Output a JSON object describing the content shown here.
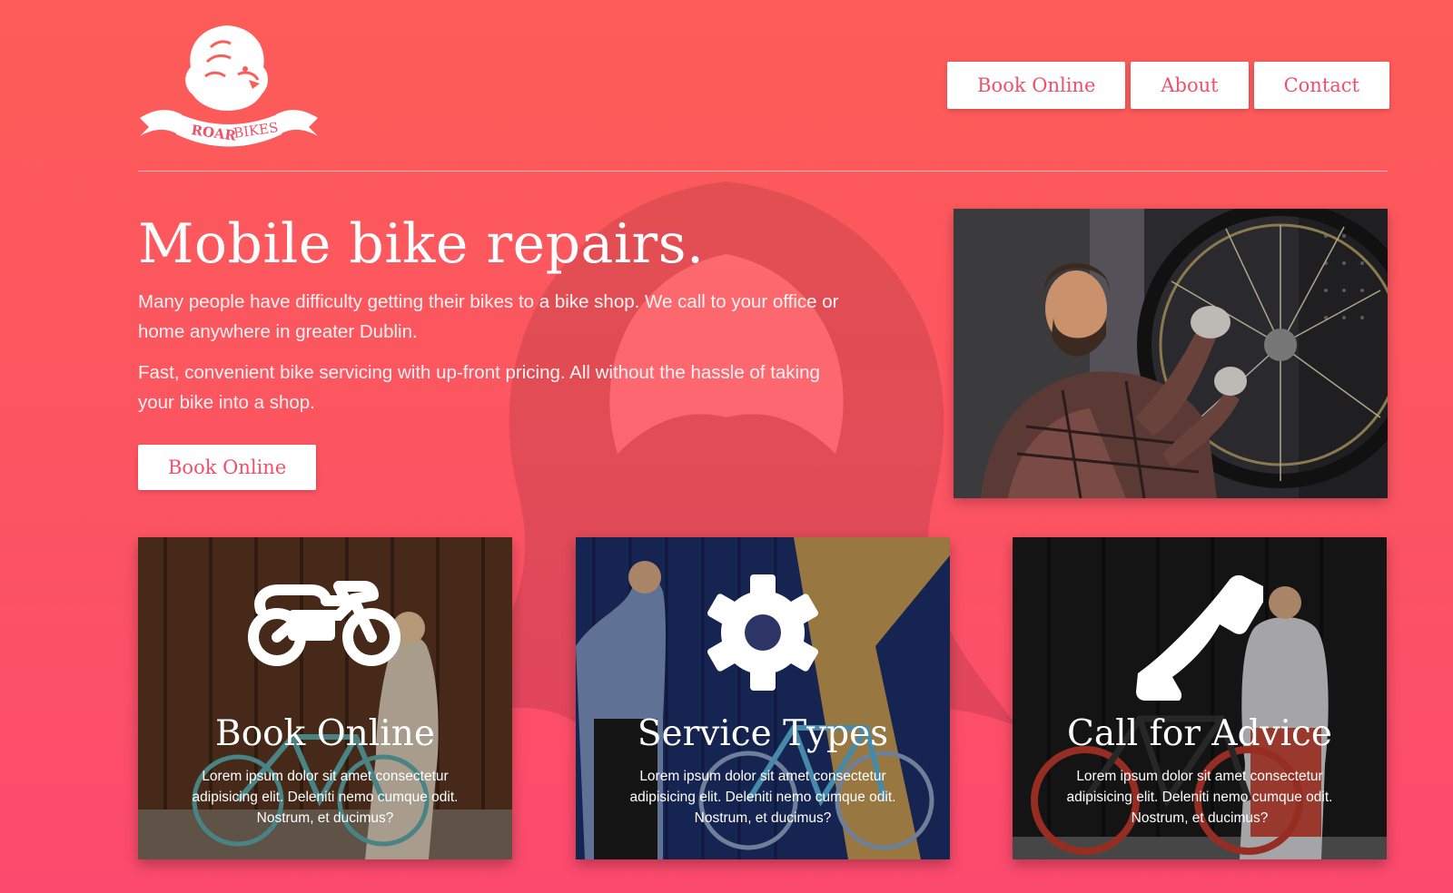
{
  "brand": {
    "logo_text_1": "ROAR",
    "logo_text_2": "BIKES",
    "colors": {
      "background_top": "#fd5c58",
      "background_bottom": "#fc4a6e",
      "button_text": "#f0506a",
      "button_bg": "#ffffff"
    }
  },
  "nav": {
    "items": [
      {
        "label": "Book Online"
      },
      {
        "label": "About"
      },
      {
        "label": "Contact"
      }
    ]
  },
  "hero": {
    "title": "Mobile bike repairs.",
    "paragraph_1": "Many people have difficulty getting their bikes to a bike shop. We call to your office or home anywhere in greater Dublin.",
    "paragraph_2": "Fast, convenient bike servicing with up-front pricing. All without the hassle of taking your bike into a shop.",
    "cta_label": "Book Online"
  },
  "features": [
    {
      "icon": "motorcycle-icon",
      "title": "Book Online",
      "text": "Lorem ipsum dolor sit amet consectetur adipisicing elit. Deleniti nemo cumque odit. Nostrum, et ducimus?"
    },
    {
      "icon": "gear-icon",
      "title": "Service Types",
      "text": "Lorem ipsum dolor sit amet consectetur adipisicing elit. Deleniti nemo cumque odit. Nostrum, et ducimus?"
    },
    {
      "icon": "phone-icon",
      "title": "Call for Advice",
      "text": "Lorem ipsum dolor sit amet consectetur adipisicing elit. Deleniti nemo cumque odit. Nostrum, et ducimus?"
    }
  ]
}
